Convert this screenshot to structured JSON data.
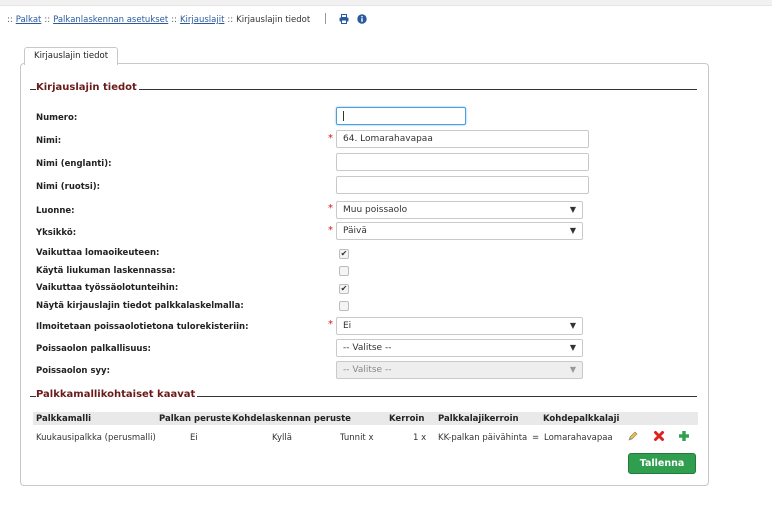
{
  "breadcrumb": {
    "items": [
      "Palkat",
      "Palkanlaskennan asetukset",
      "Kirjauslajit"
    ],
    "current": "Kirjauslajin tiedot",
    "separator": "::"
  },
  "toolbar": {
    "print_icon": "printer-icon",
    "info_icon": "info-icon"
  },
  "tab": {
    "label": "Kirjauslajin tiedot"
  },
  "section1": {
    "title": "Kirjauslajin tiedot"
  },
  "form": {
    "numero": {
      "label": "Numero:",
      "value": ""
    },
    "nimi": {
      "label": "Nimi:",
      "value": "64. Lomarahavapaa"
    },
    "nimi_en": {
      "label": "Nimi (englanti):",
      "value": ""
    },
    "nimi_ru": {
      "label": "Nimi (ruotsi):",
      "value": ""
    },
    "luonne": {
      "label": "Luonne:",
      "value": "Muu poissaolo"
    },
    "yksikko": {
      "label": "Yksikkö:",
      "value": "Päivä"
    },
    "vaikuttaa_loma": {
      "label": "Vaikuttaa lomaoikeuteen:",
      "checked": true
    },
    "liukuma": {
      "label": "Käytä liukuman laskennassa:",
      "checked": false
    },
    "tyossaolo": {
      "label": "Vaikuttaa työssäolotunteihin:",
      "checked": true
    },
    "nayta": {
      "label": "Näytä kirjauslajin tiedot palkkalaskelmalla:",
      "checked": false
    },
    "ilmoitetaan": {
      "label": "Ilmoitetaan poissaolotietona tulorekisteriin:",
      "value": "Ei"
    },
    "palkallisuus": {
      "label": "Poissaolon palkallisuus:",
      "value": "-- Valitse --"
    },
    "syy": {
      "label": "Poissaolon syy:",
      "value": "-- Valitse --"
    },
    "required_mark": "*",
    "check_mark": "✔"
  },
  "section2": {
    "title": "Palkkamallikohtaiset kaavat"
  },
  "table": {
    "headers": [
      "Palkkamalli",
      "Palkan peruste",
      "Kohdelaskennan peruste",
      "Kerroin",
      "Palkkalajikerroin",
      "Kohdepalkkalaji"
    ],
    "row": {
      "palkkamalli": "Kuukausipalkka (perusmalli)",
      "palkan_peruste": "Ei",
      "kohdelaskennan_peruste": "Kyllä",
      "tunnit": "Tunnit x",
      "kerroin": "1 x",
      "palkkalajikerroin": "KK-palkan päivähinta",
      "equals": "=",
      "kohdepalkkalaji": "Lomarahavapaa"
    },
    "actions": [
      "edit-icon",
      "delete-icon",
      "add-icon"
    ]
  },
  "buttons": {
    "save": "Tallenna"
  },
  "colors": {
    "legend": "#6b1a1a",
    "save_button": "#2f9e4f",
    "link": "#2a5a9e",
    "required": "#dd1111"
  }
}
